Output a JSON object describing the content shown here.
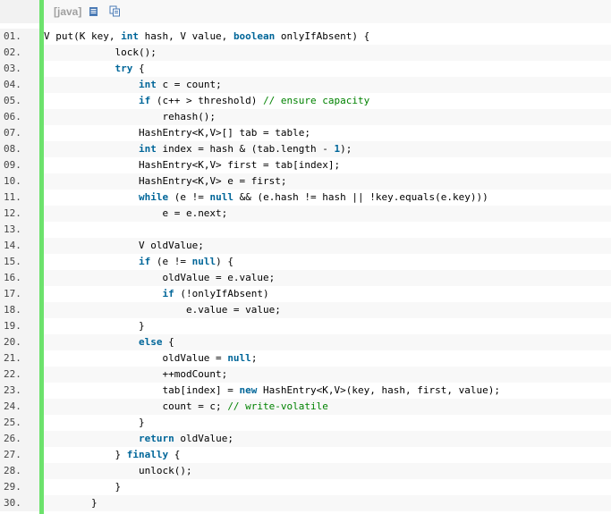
{
  "toolbar": {
    "language": "[java]",
    "view_source_icon": "view-source-icon",
    "copy_icon": "copy-icon"
  },
  "code": {
    "lines": [
      {
        "num": "01.",
        "indent": "",
        "tokens": [
          [
            "tx",
            "V put(K key, "
          ],
          [
            "kw",
            "int"
          ],
          [
            "tx",
            " hash, V value, "
          ],
          [
            "kw",
            "boolean"
          ],
          [
            "tx",
            " onlyIfAbsent) {"
          ]
        ]
      },
      {
        "num": "02.",
        "indent": "            ",
        "tokens": [
          [
            "tx",
            "lock();"
          ]
        ]
      },
      {
        "num": "03.",
        "indent": "            ",
        "tokens": [
          [
            "kw",
            "try"
          ],
          [
            "tx",
            " {"
          ]
        ]
      },
      {
        "num": "04.",
        "indent": "                ",
        "tokens": [
          [
            "kw",
            "int"
          ],
          [
            "tx",
            " c = count;"
          ]
        ]
      },
      {
        "num": "05.",
        "indent": "                ",
        "tokens": [
          [
            "kw",
            "if"
          ],
          [
            "tx",
            " (c++ > threshold) "
          ],
          [
            "cm",
            "// ensure capacity"
          ]
        ]
      },
      {
        "num": "06.",
        "indent": "                    ",
        "tokens": [
          [
            "tx",
            "rehash();"
          ]
        ]
      },
      {
        "num": "07.",
        "indent": "                ",
        "tokens": [
          [
            "tx",
            "HashEntry<K,V>[] tab = table;"
          ]
        ]
      },
      {
        "num": "08.",
        "indent": "                ",
        "tokens": [
          [
            "kw",
            "int"
          ],
          [
            "tx",
            " index = hash & (tab.length - "
          ],
          [
            "kw",
            "1"
          ],
          [
            "tx",
            ");"
          ]
        ]
      },
      {
        "num": "09.",
        "indent": "                ",
        "tokens": [
          [
            "tx",
            "HashEntry<K,V> first = tab[index];"
          ]
        ]
      },
      {
        "num": "10.",
        "indent": "                ",
        "tokens": [
          [
            "tx",
            "HashEntry<K,V> e = first;"
          ]
        ]
      },
      {
        "num": "11.",
        "indent": "                ",
        "tokens": [
          [
            "kw",
            "while"
          ],
          [
            "tx",
            " (e != "
          ],
          [
            "kw",
            "null"
          ],
          [
            "tx",
            " && (e.hash != hash || !key.equals(e.key)))"
          ]
        ]
      },
      {
        "num": "12.",
        "indent": "                    ",
        "tokens": [
          [
            "tx",
            "e = e.next;"
          ]
        ]
      },
      {
        "num": "13.",
        "indent": "",
        "tokens": []
      },
      {
        "num": "14.",
        "indent": "                ",
        "tokens": [
          [
            "tx",
            "V oldValue;"
          ]
        ]
      },
      {
        "num": "15.",
        "indent": "                ",
        "tokens": [
          [
            "kw",
            "if"
          ],
          [
            "tx",
            " (e != "
          ],
          [
            "kw",
            "null"
          ],
          [
            "tx",
            ") {"
          ]
        ]
      },
      {
        "num": "16.",
        "indent": "                    ",
        "tokens": [
          [
            "tx",
            "oldValue = e.value;"
          ]
        ]
      },
      {
        "num": "17.",
        "indent": "                    ",
        "tokens": [
          [
            "kw",
            "if"
          ],
          [
            "tx",
            " (!onlyIfAbsent)"
          ]
        ]
      },
      {
        "num": "18.",
        "indent": "                        ",
        "tokens": [
          [
            "tx",
            "e.value = value;"
          ]
        ]
      },
      {
        "num": "19.",
        "indent": "                ",
        "tokens": [
          [
            "tx",
            "}"
          ]
        ]
      },
      {
        "num": "20.",
        "indent": "                ",
        "tokens": [
          [
            "kw",
            "else"
          ],
          [
            "tx",
            " {"
          ]
        ]
      },
      {
        "num": "21.",
        "indent": "                    ",
        "tokens": [
          [
            "tx",
            "oldValue = "
          ],
          [
            "kw",
            "null"
          ],
          [
            "tx",
            ";"
          ]
        ]
      },
      {
        "num": "22.",
        "indent": "                    ",
        "tokens": [
          [
            "tx",
            "++modCount;"
          ]
        ]
      },
      {
        "num": "23.",
        "indent": "                    ",
        "tokens": [
          [
            "tx",
            "tab[index] = "
          ],
          [
            "kw",
            "new"
          ],
          [
            "tx",
            " HashEntry<K,V>(key, hash, first, value);"
          ]
        ]
      },
      {
        "num": "24.",
        "indent": "                    ",
        "tokens": [
          [
            "tx",
            "count = c; "
          ],
          [
            "cm",
            "// write-volatile"
          ]
        ]
      },
      {
        "num": "25.",
        "indent": "                ",
        "tokens": [
          [
            "tx",
            "}"
          ]
        ]
      },
      {
        "num": "26.",
        "indent": "                ",
        "tokens": [
          [
            "kw",
            "return"
          ],
          [
            "tx",
            " oldValue;"
          ]
        ]
      },
      {
        "num": "27.",
        "indent": "            ",
        "tokens": [
          [
            "tx",
            "} "
          ],
          [
            "kw",
            "finally"
          ],
          [
            "tx",
            " {"
          ]
        ]
      },
      {
        "num": "28.",
        "indent": "                ",
        "tokens": [
          [
            "tx",
            "unlock();"
          ]
        ]
      },
      {
        "num": "29.",
        "indent": "            ",
        "tokens": [
          [
            "tx",
            "}"
          ]
        ]
      },
      {
        "num": "30.",
        "indent": "        ",
        "tokens": [
          [
            "tx",
            "}"
          ]
        ]
      }
    ]
  },
  "colors": {
    "keyword": "#006699",
    "comment": "#008200",
    "gutter_bar": "#6ce26c",
    "language_label": "#a0a0a0"
  }
}
